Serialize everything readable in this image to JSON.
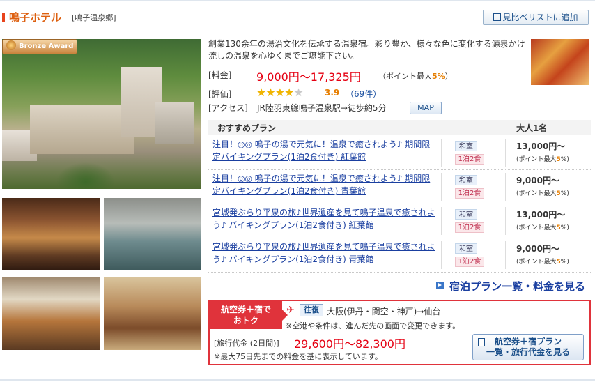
{
  "hotel": {
    "name": "鳴子ホテル",
    "area": "[鳴子温泉郷]",
    "compare_button": "見比べリストに追加",
    "badge": "Bronze Award",
    "description": "創業130余年の湯治文化を伝承する温泉宿。彩り豊か、様々な色に変化する源泉かけ流しの温泉を心ゆくまでご堪能下さい。",
    "price_label": "[料金]",
    "price_range": "9,000円〜17,325円",
    "point_prefix": "（ポイント最大",
    "point_pct": "5%",
    "point_suffix": "）",
    "rating_label": "[評価]",
    "rating_value": 3.9,
    "rating_text": "3.9",
    "rating_stars_full": 4,
    "reviews_open": "（",
    "reviews_count": "69件",
    "reviews_close": "）",
    "access_label": "[アクセス]",
    "access_text": "JR陸羽東線鳴子温泉駅→徒歩約5分",
    "map_button": "MAP"
  },
  "plans": {
    "header_plan": "おすすめプラン",
    "header_price": "大人1名",
    "items": [
      {
        "name": "注目！◎◎ 鳴子の湯で元気に！温泉で癒されよう♪ 期間限定バイキングプラン(1泊2食付き) 紅葉館",
        "room": "和室",
        "meal": "1泊2食",
        "price": "13,000円〜",
        "pt_prefix": "(ポイント最大",
        "pt_pct": "5",
        "pt_suffix": "%)"
      },
      {
        "name": "注目！◎◎ 鳴子の湯で元気に！温泉で癒されよう♪ 期間限定バイキングプラン(1泊2食付き) 青葉館",
        "room": "和室",
        "meal": "1泊2食",
        "price": "9,000円〜",
        "pt_prefix": "(ポイント最大",
        "pt_pct": "5",
        "pt_suffix": "%)"
      },
      {
        "name": "宮城発ぶらり平泉の旅♪世界遺産を見て鳴子温泉で癒されよう♪ バイキングプラン(1泊2食付き) 紅葉館",
        "room": "和室",
        "meal": "1泊2食",
        "price": "13,000円〜",
        "pt_prefix": "(ポイント最大",
        "pt_pct": "5",
        "pt_suffix": "%)"
      },
      {
        "name": "宮城発ぶらり平泉の旅♪世界遺産を見て鳴子温泉で癒されよう♪ バイキングプラン(1泊2食付き) 青葉館",
        "room": "和室",
        "meal": "1泊2食",
        "price": "9,000円〜",
        "pt_prefix": "(ポイント最大",
        "pt_pct": "5",
        "pt_suffix": "%)"
      }
    ],
    "all_plans_link": "宿泊プラン一覧・料金を見る"
  },
  "air": {
    "label_line1": "航空券＋宿で",
    "label_line2": "おトク",
    "roundtrip": "往復",
    "route": "大阪(伊丹・関空・神戸)→仙台",
    "note": "※空港や条件は、進んだ先の画面で変更できます。",
    "travel_label": "[旅行代金 (2日間)]",
    "travel_price": "29,600円〜82,300円",
    "travel_note": "※最大75日先までの料金を基に表示しています。",
    "button_line1": "航空券＋宿プラン",
    "button_line2": "一覧・旅行代金を見る"
  },
  "colors": {
    "accent_orange": "#dd6010",
    "price_red": "#e50012",
    "link_blue": "#1a3fa0",
    "air_red": "#e0333b"
  },
  "icons": [
    "plus-box-icon",
    "medal-icon",
    "star-icon",
    "arrow-icon",
    "plane-icon",
    "document-icon"
  ]
}
